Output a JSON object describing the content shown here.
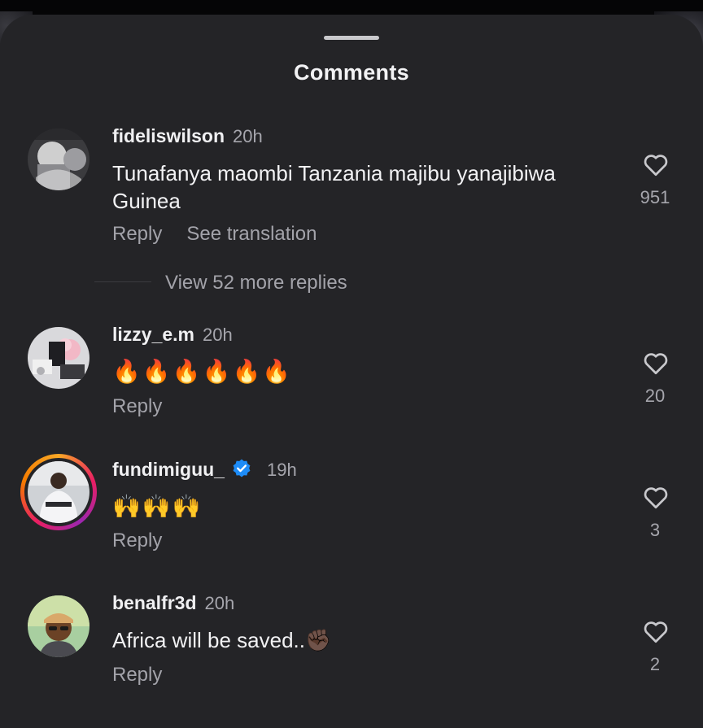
{
  "sheet": {
    "title": "Comments"
  },
  "comments": [
    {
      "username": "fideliswilson",
      "time": "20h",
      "text": "Tunafanya maombi Tanzania majibu yanajibiwa Guinea",
      "reply_label": "Reply",
      "translate_label": "See translation",
      "likes": "951",
      "view_replies": "View 52 more replies"
    },
    {
      "username": "lizzy_e.m",
      "time": "20h",
      "text": "🔥🔥🔥🔥🔥🔥",
      "reply_label": "Reply",
      "likes": "20"
    },
    {
      "username": "fundimiguu_",
      "time": "19h",
      "verified": true,
      "text": "🙌🙌🙌",
      "reply_label": "Reply",
      "likes": "3"
    },
    {
      "username": "benalfr3d",
      "time": "20h",
      "text": "Africa will be saved..✊🏿",
      "reply_label": "Reply",
      "likes": "2"
    }
  ],
  "icons": {
    "like": "heart-outline-icon",
    "verified": "verified-badge-icon",
    "handle": "drag-handle"
  },
  "colors": {
    "sheet_bg": "#242427",
    "text_primary": "#f2f2f4",
    "text_secondary": "#a3a3aa",
    "verified_blue": "#1d8cf8"
  }
}
